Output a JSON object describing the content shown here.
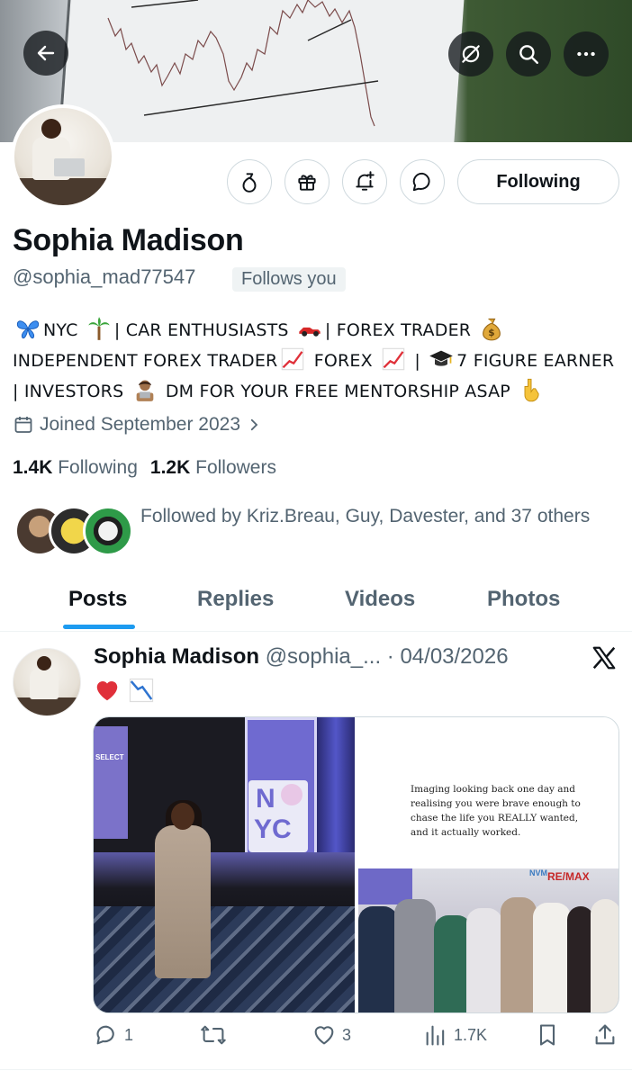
{
  "header": {
    "back_icon": "back-arrow-icon",
    "actions": [
      "explore-icon",
      "search-icon",
      "more-icon"
    ]
  },
  "profile": {
    "name": "Sophia Madison",
    "handle": "@sophia_mad77547",
    "follows_you": "Follows you",
    "follow_button": "Following",
    "action_icons": [
      "tip-icon",
      "gift-icon",
      "notification-bell-icon",
      "message-icon"
    ],
    "bio": {
      "line1_a": "NYC",
      "line1_b": "| CAR ENTHUSIASTS",
      "line1_c": "| FOREX TRADER",
      "line2_a": "INDEPENDENT FOREX TRADER",
      "line2_b": "FOREX",
      "line2_c": "|",
      "line2_d": "7 FIGURE EARNER",
      "line3_a": "| INVESTORS",
      "line3_b": "DM FOR YOUR FREE MENTORSHIP ASAP"
    },
    "joined": "Joined September 2023",
    "following_count": "1.4K",
    "following_label": "Following",
    "followers_count": "1.2K",
    "followers_label": "Followers",
    "followed_by": "Followed by Kriz.Breau, Guy, Davester, and 37 others"
  },
  "tabs": [
    {
      "label": "Posts",
      "active": true
    },
    {
      "label": "Replies",
      "active": false
    },
    {
      "label": "Videos",
      "active": false
    },
    {
      "label": "Photos",
      "active": false
    }
  ],
  "post": {
    "author": "Sophia Madison",
    "handle": "@sophia_...",
    "date": "· 04/03/2026",
    "source_icon": "x-logo-icon",
    "text_emojis": [
      "heart-icon",
      "chart-decreasing-icon"
    ],
    "image_left": {
      "sign_nyc_top": "N",
      "sign_nyc_bottom": "YC",
      "screen_text": "SELECT"
    },
    "image_right": {
      "quote": "Imaging looking back one day and realising you were brave enough to chase the life you REALLY wanted, and it actually worked.",
      "logo": "RE/MAX",
      "sign": "NVM"
    },
    "replies": "1",
    "reposts": "",
    "likes": "3",
    "views": "1.7K"
  },
  "colors": {
    "accent": "#1d9bf0",
    "text_primary": "#0f1419",
    "text_secondary": "#536471",
    "border": "#cfd9de"
  }
}
